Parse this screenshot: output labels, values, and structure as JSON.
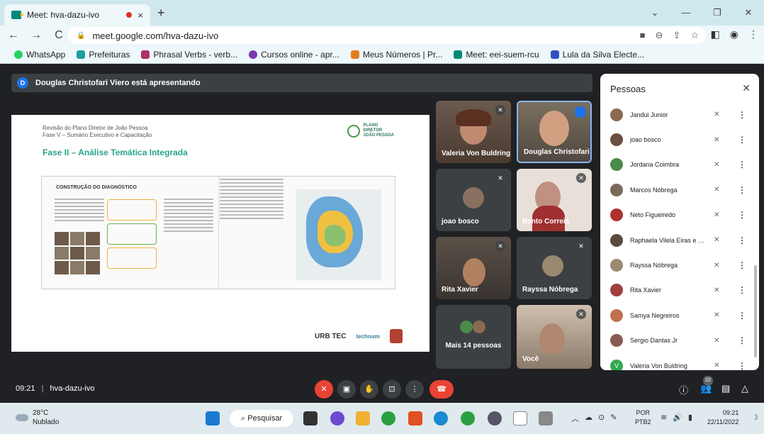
{
  "browser": {
    "tab_title": "Meet: hva-dazu-ivo",
    "tab_close": "×",
    "new_tab": "+",
    "url": "meet.google.com/hva-dazu-ivo",
    "window_controls": [
      "⌄",
      "—",
      "❐",
      "✕"
    ],
    "nav": [
      "←",
      "→",
      "C"
    ]
  },
  "bookmarks": [
    {
      "label": "WhatsApp",
      "color": "#25d366"
    },
    {
      "label": "Prefeituras",
      "color": "#1aa0a0"
    },
    {
      "label": "Phrasal Verbs - verb...",
      "color": "#b0306a"
    },
    {
      "label": "Cursos online - apr...",
      "color": "#7a3ab0"
    },
    {
      "label": "Meus Números | Pr...",
      "color": "#e08020"
    },
    {
      "label": "Meet: eei-suem-rcu",
      "color": "#00897b"
    },
    {
      "label": "Lula da Silva Electe...",
      "color": "#3050c0"
    }
  ],
  "meet": {
    "presenter_initial": "D",
    "presenter_text": "Douglas Christofari Viero está apresentando",
    "time": "09:21",
    "separator": "|",
    "meeting_code": "hva-dazu-ivo",
    "participant_count": "22"
  },
  "slide": {
    "header_line1": "Revisão do Plano Diretor de João Pessoa",
    "header_line2": "Fase V – Sumário Executivo e Capacitação",
    "logo_text": [
      "PLANO",
      "DIRETOR",
      "JOÃO PESSOA"
    ],
    "phase_title": "Fase II – Análise Temática Integrada",
    "spread_title": "CONSTRUÇÃO DO DIAGNÓSTICO",
    "footer_logos": [
      "URB TEC",
      "technum"
    ]
  },
  "tiles": [
    {
      "name": "Valeria Von Buldring",
      "muted": true
    },
    {
      "name": "Douglas Christofari",
      "muted": false,
      "speaking": true
    },
    {
      "name": "joao bosco",
      "muted": true
    },
    {
      "name": "Bento Correia",
      "muted": true
    },
    {
      "name": "Rita Xavier",
      "muted": true
    },
    {
      "name": "Rayssa Nóbrega",
      "muted": true
    },
    {
      "name": "Mais 14 pessoas",
      "muted": false
    },
    {
      "name": "Você",
      "muted": true
    }
  ],
  "people": {
    "title": "Pessoas",
    "close": "✕",
    "list": [
      {
        "name": "Jandui Junior",
        "avatar_color": "#8a6a50",
        "initial": ""
      },
      {
        "name": "joao bosco",
        "avatar_color": "#6a5040",
        "initial": ""
      },
      {
        "name": "Jordana Coimbra",
        "avatar_color": "#4a8a4a",
        "initial": ""
      },
      {
        "name": "Marcos Nóbrega",
        "avatar_color": "#7a6a5a",
        "initial": ""
      },
      {
        "name": "Neto Figueiredo",
        "avatar_color": "#b03030",
        "initial": ""
      },
      {
        "name": "Raphaela Vilela Eiras e Pai...",
        "avatar_color": "#5a4a40",
        "initial": ""
      },
      {
        "name": "Rayssa Nóbrega",
        "avatar_color": "#9a8a70",
        "initial": ""
      },
      {
        "name": "Rita Xavier",
        "avatar_color": "#a04040",
        "initial": ""
      },
      {
        "name": "Samya Negreiros",
        "avatar_color": "#c07050",
        "initial": ""
      },
      {
        "name": "Sergio Dantas Jr",
        "avatar_color": "#8a5a50",
        "initial": ""
      },
      {
        "name": "Valeria Von Buldring",
        "avatar_color": "#34a853",
        "initial": "V"
      }
    ]
  },
  "taskbar": {
    "temp": "28°C",
    "weather": "Nublado",
    "search": "Pesquisar",
    "lang1": "POR",
    "lang2": "PTB2",
    "time": "09:21",
    "date": "22/11/2022"
  }
}
